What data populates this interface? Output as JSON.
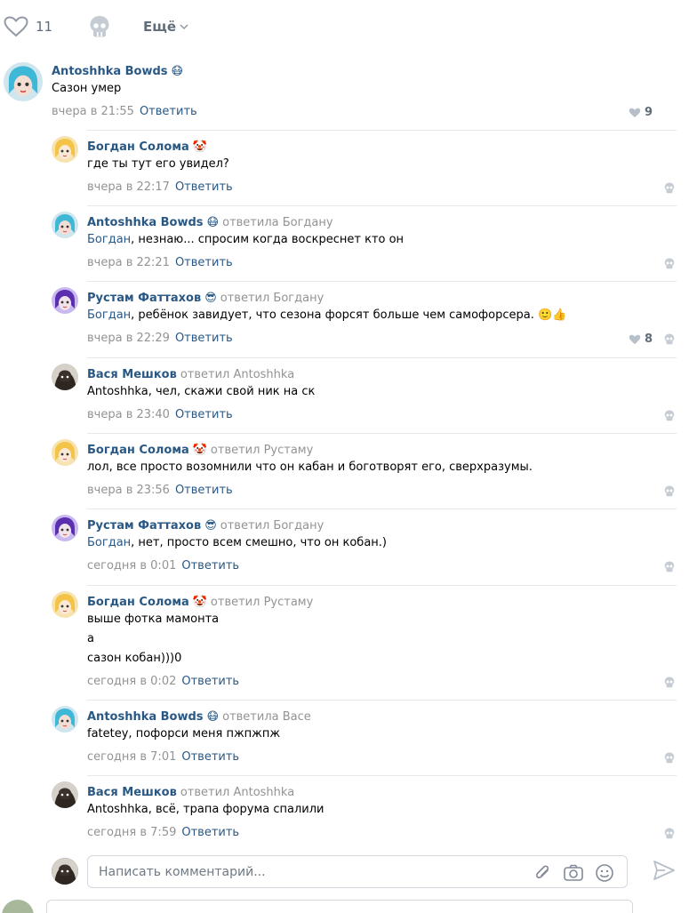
{
  "post_actions": {
    "like_count": "11",
    "more_label": "Ещё"
  },
  "comments": [
    {
      "author": "Antoshhka Bowds",
      "emoji": "😷",
      "reply_to": "",
      "text_prefix": "",
      "text": "Сазон умер",
      "time": "вчера в 21:55",
      "reply_label": "Ответить",
      "likes": "9"
    },
    {
      "author": "Богдан Солома",
      "emoji": "🤡",
      "reply_to": "",
      "text_prefix": "",
      "text": "где ты тут его увидел?",
      "time": "вчера в 22:17",
      "reply_label": "Ответить",
      "likes": ""
    },
    {
      "author": "Antoshhka Bowds",
      "emoji": "😷",
      "reply_to": "ответила Богдану",
      "text_prefix": "Богдан",
      "text": ", незнаю... спросим когда воскреснет кто он",
      "time": "вчера в 22:21",
      "reply_label": "Ответить",
      "likes": ""
    },
    {
      "author": "Рустам Фаттахов",
      "emoji": "😎",
      "reply_to": "ответил Богдану",
      "text_prefix": "Богдан",
      "text": ", ребёнок завидует, что сезона форсят больше чем самофорсера. 🙂👍",
      "time": "вчера в 22:29",
      "reply_label": "Ответить",
      "likes": "8"
    },
    {
      "author": "Вася Мешков",
      "emoji": "",
      "reply_to": "ответил Antoshhka",
      "text_prefix": "",
      "text": "Antoshhka, чел, скажи свой ник на ск",
      "time": "вчера в 23:40",
      "reply_label": "Ответить",
      "likes": ""
    },
    {
      "author": "Богдан Солома",
      "emoji": "🤡",
      "reply_to": "ответил Рустаму",
      "text_prefix": "",
      "text": "лол, все просто возомнили что он кабан и боготворят его, сверхразумы.",
      "time": "вчера в 23:56",
      "reply_label": "Ответить",
      "likes": ""
    },
    {
      "author": "Рустам Фаттахов",
      "emoji": "😎",
      "reply_to": "ответил Богдану",
      "text_prefix": "Богдан",
      "text": ", нет, просто всем смешно, что он кобан.)",
      "time": "сегодня в 0:01",
      "reply_label": "Ответить",
      "likes": ""
    },
    {
      "author": "Богдан Солома",
      "emoji": "🤡",
      "reply_to": "ответил Рустаму",
      "text_prefix": "",
      "text": "выше фотка мамонта",
      "text_line2": "а",
      "text_line3": "сазон кобан)))0",
      "time": "сегодня в 0:02",
      "reply_label": "Ответить",
      "likes": ""
    },
    {
      "author": "Antoshhka Bowds",
      "emoji": "😷",
      "reply_to": "ответила Васе",
      "text_prefix": "",
      "text": "fatetey, пофорси меня пжпжпж",
      "time": "сегодня в 7:01",
      "reply_label": "Ответить",
      "likes": ""
    },
    {
      "author": "Вася Мешков",
      "emoji": "",
      "reply_to": "ответил Antoshhka",
      "text_prefix": "",
      "text": "Antoshhka, всё, трапа форума спалили",
      "time": "сегодня в 7:59",
      "reply_label": "Ответить",
      "likes": ""
    }
  ],
  "composer": {
    "placeholder": "Написать комментарий..."
  },
  "colors": {
    "link": "#2a5885",
    "muted": "#939393",
    "icon": "#b7bfc9"
  }
}
